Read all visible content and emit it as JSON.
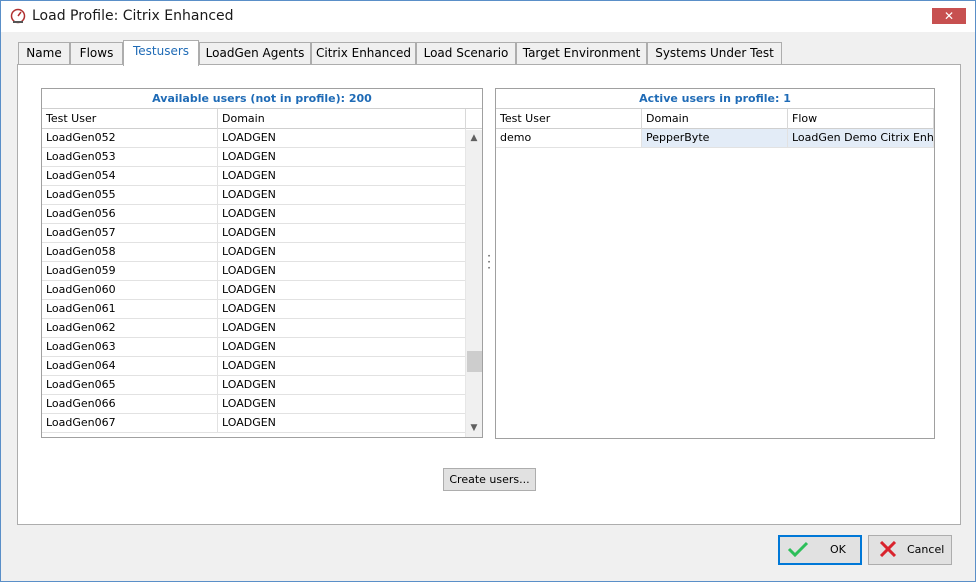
{
  "window": {
    "title": "Load Profile: Citrix Enhanced",
    "close_glyph": "✕"
  },
  "tabs": [
    {
      "label": "Name",
      "active": false
    },
    {
      "label": "Flows",
      "active": false
    },
    {
      "label": "Testusers",
      "active": true
    },
    {
      "label": "LoadGen Agents",
      "active": false
    },
    {
      "label": "Citrix Enhanced",
      "active": false
    },
    {
      "label": "Load Scenario",
      "active": false
    },
    {
      "label": "Target Environment",
      "active": false
    },
    {
      "label": "Systems Under Test",
      "active": false
    }
  ],
  "available": {
    "title": "Available users (not in profile): 200",
    "columns": [
      "Test User",
      "Domain"
    ],
    "rows": [
      [
        "LoadGen052",
        "LOADGEN"
      ],
      [
        "LoadGen053",
        "LOADGEN"
      ],
      [
        "LoadGen054",
        "LOADGEN"
      ],
      [
        "LoadGen055",
        "LOADGEN"
      ],
      [
        "LoadGen056",
        "LOADGEN"
      ],
      [
        "LoadGen057",
        "LOADGEN"
      ],
      [
        "LoadGen058",
        "LOADGEN"
      ],
      [
        "LoadGen059",
        "LOADGEN"
      ],
      [
        "LoadGen060",
        "LOADGEN"
      ],
      [
        "LoadGen061",
        "LOADGEN"
      ],
      [
        "LoadGen062",
        "LOADGEN"
      ],
      [
        "LoadGen063",
        "LOADGEN"
      ],
      [
        "LoadGen064",
        "LOADGEN"
      ],
      [
        "LoadGen065",
        "LOADGEN"
      ],
      [
        "LoadGen066",
        "LOADGEN"
      ],
      [
        "LoadGen067",
        "LOADGEN"
      ]
    ]
  },
  "active": {
    "title": "Active users in profile: 1",
    "columns": [
      "Test User",
      "Domain",
      "Flow"
    ],
    "rows": [
      [
        "demo",
        "PepperByte",
        "LoadGen Demo Citrix Enha..."
      ]
    ]
  },
  "buttons": {
    "create_users": "Create users...",
    "ok": "OK",
    "cancel": "Cancel"
  },
  "colors": {
    "accent": "#1f6bb6",
    "close": "#c75050",
    "ok_check": "#2dbf5a",
    "cancel_x": "#d9232d"
  }
}
